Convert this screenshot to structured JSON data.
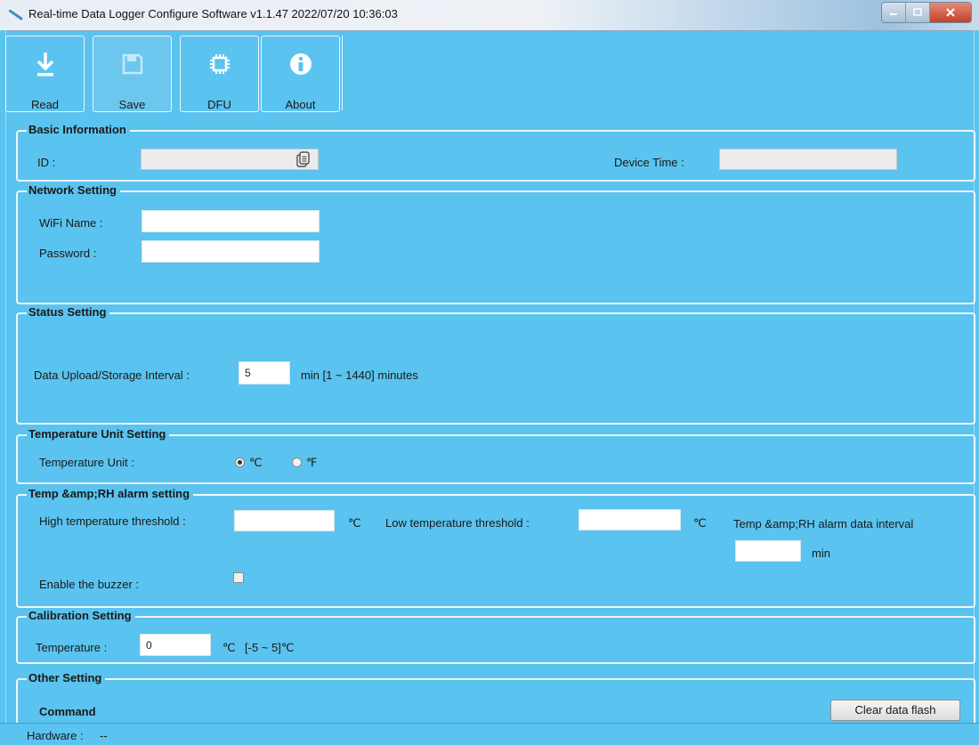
{
  "window": {
    "title": "Real-time Data Logger Configure Software v1.1.47  2022/07/20 10:36:03"
  },
  "toolbar": {
    "read_label": "Read",
    "save_label": "Save",
    "dfu_label": "DFU",
    "about_label": "About"
  },
  "basic_info": {
    "title": "Basic Information",
    "id_label": "ID :",
    "id_value": "",
    "device_time_label": "Device Time :",
    "device_time_value": ""
  },
  "network": {
    "title": "Network Setting",
    "wifi_label": "WiFi Name :",
    "wifi_value": "",
    "password_label": "Password :",
    "password_value": ""
  },
  "status": {
    "title": "Status Setting",
    "interval_label": "Data Upload/Storage Interval :",
    "interval_value": "5",
    "interval_hint": "min  [1 ~ 1440] minutes"
  },
  "temp_unit": {
    "title": "Temperature Unit Setting",
    "label": "Temperature Unit :",
    "options": [
      "℃",
      "℉"
    ],
    "selected": "℃"
  },
  "alarm": {
    "title": "Temp &amp;RH alarm setting",
    "high_label": "High temperature threshold :",
    "high_value": "",
    "high_unit": "℃",
    "low_label": "Low temperature threshold :",
    "low_value": "",
    "low_unit": "℃",
    "interval_label": "Temp &amp;RH alarm data interval",
    "interval_value": "",
    "interval_unit": "min",
    "buzzer_label": "Enable the buzzer :",
    "buzzer_checked": false
  },
  "calibration": {
    "title": "Calibration Setting",
    "temp_label": "Temperature :",
    "temp_value": "0",
    "temp_unit": "℃",
    "temp_range": "[-5 ~ 5]℃"
  },
  "other": {
    "title": "Other Setting",
    "command_label": "Command",
    "clear_button": "Clear data flash"
  },
  "statusbar": {
    "hardware_label": "Hardware :",
    "hardware_value": "--"
  }
}
